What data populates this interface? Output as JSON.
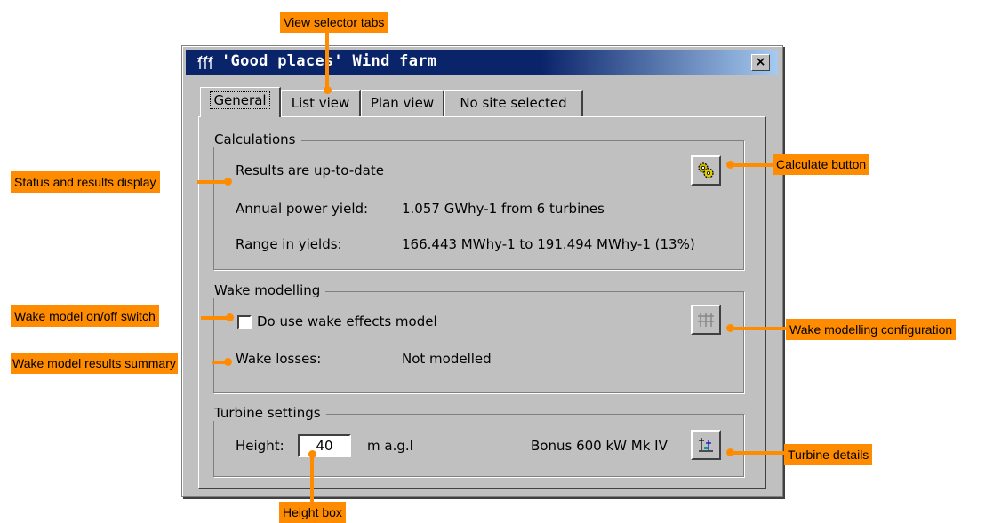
{
  "window": {
    "title": "'Good places' Wind farm",
    "close_label": "×"
  },
  "tabs": [
    {
      "label": "General",
      "active": true
    },
    {
      "label": "List view",
      "active": false
    },
    {
      "label": "Plan view",
      "active": false
    },
    {
      "label": "No site selected",
      "active": false
    }
  ],
  "calculations": {
    "title": "Calculations",
    "status": "Results are up-to-date",
    "yield_label": "Annual power yield:",
    "yield_value": "1.057 GWhy-1 from 6 turbines",
    "range_label": "Range in yields:",
    "range_value": "166.443 MWhy-1 to 191.494 MWhy-1 (13%)",
    "button_icon": "gears-icon"
  },
  "wake": {
    "title": "Wake modelling",
    "checkbox_label": "Do use wake effects model",
    "checked": false,
    "losses_label": "Wake losses:",
    "losses_value": "Not modelled",
    "config_icon": "wind-farm-icon"
  },
  "turbine": {
    "title": "Turbine settings",
    "height_label": "Height:",
    "height_value": "40",
    "height_unit": "m a.g.l",
    "model": "Bonus 600 kW Mk IV",
    "details_icon": "turbine-details-icon"
  },
  "callouts": {
    "tabs": "View selector tabs",
    "status": "Status and results display",
    "wake_switch": "Wake model on/off switch",
    "wake_summary": "Wake model results summary",
    "calc_button": "Calculate button",
    "wake_config": "Wake modelling configuration",
    "turbine_details": "Turbine details",
    "height_box": "Height box"
  },
  "colors": {
    "callout": "#ff8c00",
    "titlebar": "#0a246a",
    "dialog": "#c0c0c0"
  }
}
